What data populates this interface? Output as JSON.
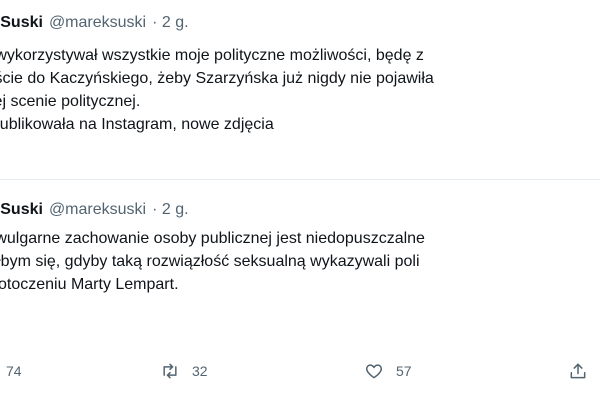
{
  "tweets": [
    {
      "author_name": "ek Suski",
      "handle": "@mareksuski",
      "time": "· 2 g.",
      "body": "e wykorzystywał wszystkie moje polityczne możliwości, będę z\npiście do Kaczyńskiego, żeby Szarzyńska już nigdy nie pojawiła\nkiej scenie politycznej.\nopublikowała na Instagram, nowe zdjęcia"
    },
    {
      "author_name": "ek Suski",
      "handle": "@mareksuski",
      "time": "· 2 g.",
      "body": "e wulgarne zachowanie osoby publicznej jest niedopuszczalne\nwiłbym się, gdyby taką rozwiązłość seksualną wykazywali poli\nw otoczeniu Marty Lempart.",
      "actions": {
        "replies": "74",
        "retweets": "32",
        "likes": "57"
      }
    }
  ],
  "icons": {
    "reply": "reply-icon",
    "retweet": "retweet-icon",
    "like": "heart-icon",
    "share": "share-icon"
  },
  "colors": {
    "text": "#0f1419",
    "secondary": "#536471",
    "divider": "#e6ecf0"
  }
}
